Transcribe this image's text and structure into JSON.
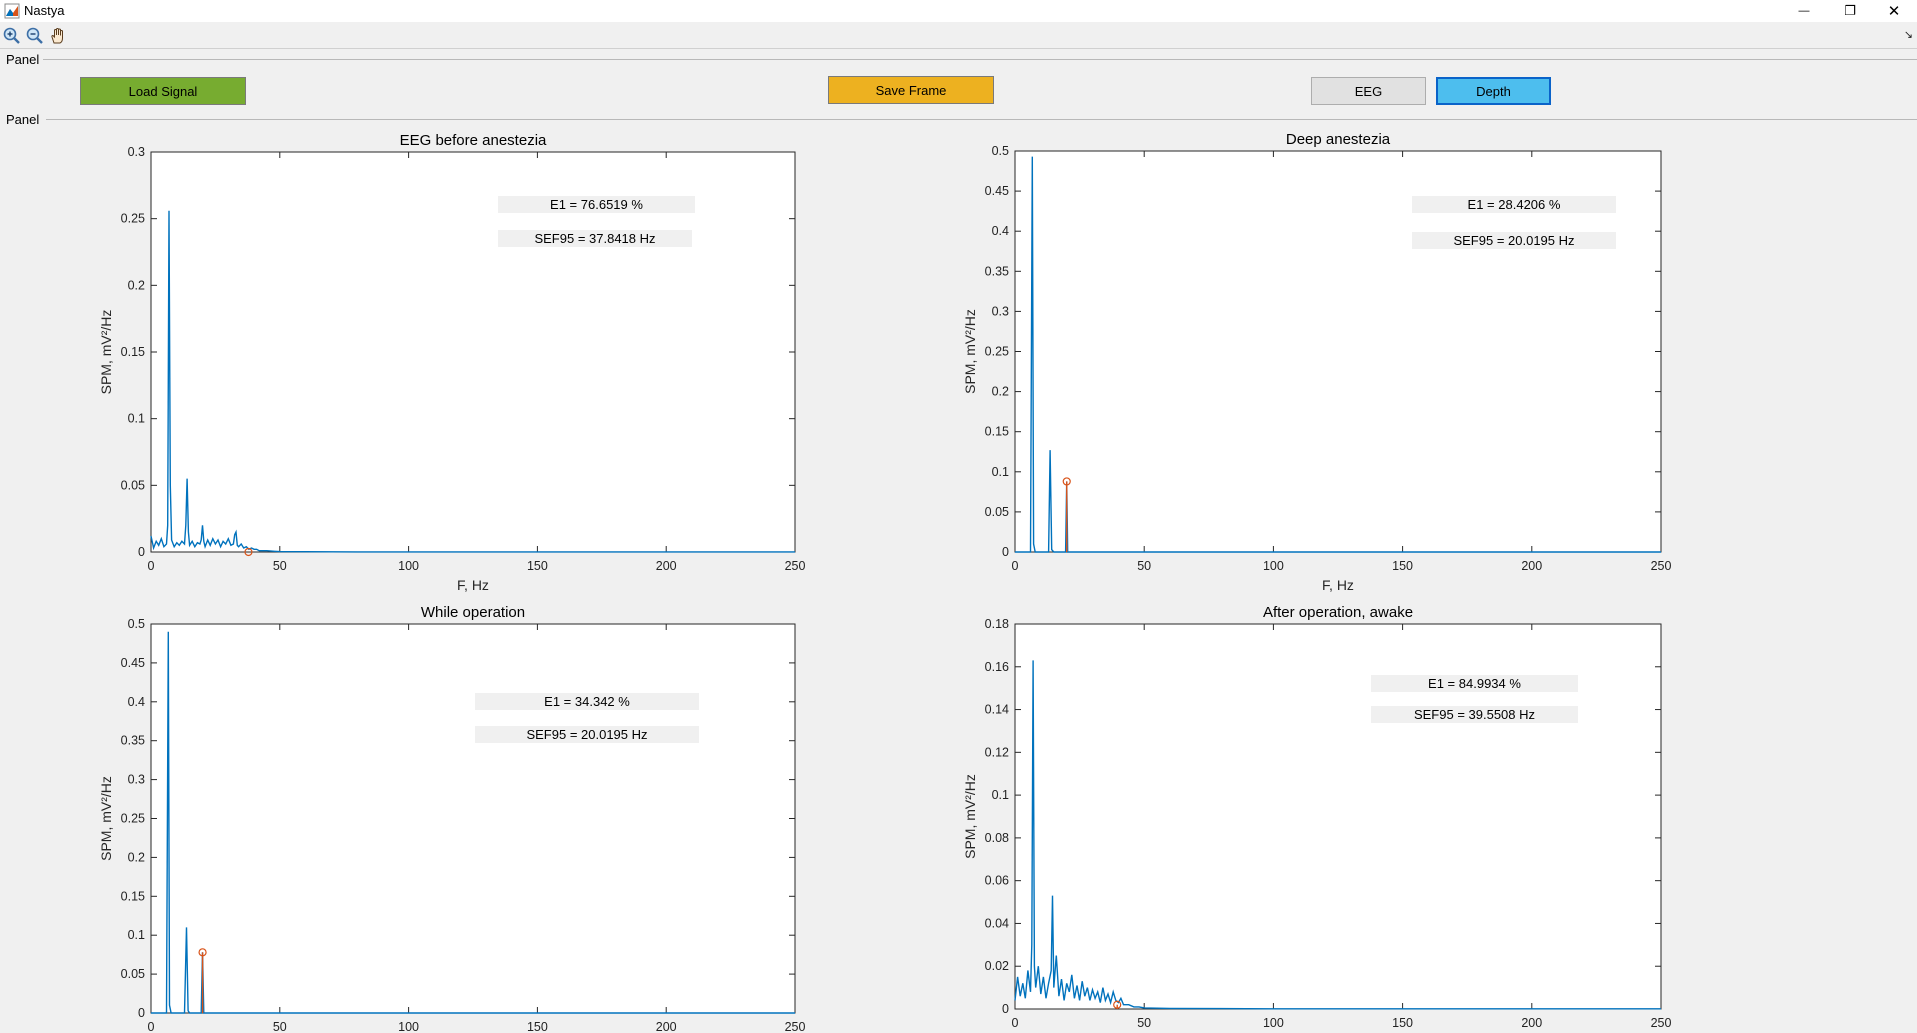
{
  "window": {
    "title": "Nastya",
    "minimize_glyph": "—",
    "restore_glyph": "❐",
    "close_glyph": "✕"
  },
  "toolbar": {
    "icons": [
      "zoom-in-icon",
      "zoom-out-icon",
      "pan-hand-icon"
    ],
    "expand_glyph": "↘"
  },
  "panels": {
    "top_label": "Panel",
    "bottom_label": "Panel"
  },
  "buttons": {
    "load_signal": "Load Signal",
    "save_frame": "Save Frame",
    "eeg": "EEG",
    "depth": "Depth"
  },
  "colors": {
    "spectrum_line": "#0072bd",
    "marker": "#d95319",
    "load_button": "#77ac30",
    "save_button": "#edb120",
    "depth_button": "#4dbeee",
    "info_box": "#f0f0f0"
  },
  "chart_data": [
    {
      "type": "line",
      "title": "EEG before anestezia",
      "xlabel": "F, Hz",
      "ylabel": "SPM, mV²/Hz",
      "xlim": [
        0,
        250
      ],
      "ylim": [
        0,
        0.3
      ],
      "xticks": [
        "0",
        "50",
        "100",
        "150",
        "200",
        "250"
      ],
      "yticks": [
        "0",
        "0.05",
        "0.1",
        "0.15",
        "0.2",
        "0.25",
        "0.3"
      ],
      "info": [
        "E1 = 76.6519 %",
        "SEF95 = 37.8418 Hz"
      ],
      "marker": {
        "x": 37.84,
        "y": 0
      },
      "series": [
        {
          "x": [
            0,
            1,
            2,
            3,
            4,
            5,
            6,
            6.5,
            7,
            7.5,
            8,
            9,
            10,
            11,
            12,
            13,
            13.5,
            14,
            14.5,
            15,
            16,
            17,
            18,
            19,
            19.5,
            20,
            20.5,
            21,
            22,
            23,
            24,
            25,
            26,
            27,
            28,
            29,
            30,
            31,
            32,
            32.5,
            33,
            33.5,
            34,
            35,
            36,
            37,
            38,
            39,
            40,
            41,
            42,
            45,
            48,
            50,
            60,
            80,
            100,
            150,
            200,
            250
          ],
          "y": [
            0.012,
            0.003,
            0.008,
            0.005,
            0.01,
            0.004,
            0.006,
            0.02,
            0.256,
            0.05,
            0.009,
            0.004,
            0.007,
            0.005,
            0.008,
            0.006,
            0.02,
            0.055,
            0.015,
            0.005,
            0.008,
            0.004,
            0.007,
            0.006,
            0.009,
            0.02,
            0.008,
            0.004,
            0.009,
            0.005,
            0.01,
            0.006,
            0.009,
            0.004,
            0.008,
            0.006,
            0.01,
            0.005,
            0.006,
            0.013,
            0.015,
            0.005,
            0.004,
            0.006,
            0.003,
            0.004,
            0.002,
            0.003,
            0.002,
            0.002,
            0.001,
            0.001,
            0.0005,
            0.0003,
            0.0002,
            0.0001,
            0.0001,
            0.0001,
            0.0001,
            0.0001
          ]
        }
      ]
    },
    {
      "type": "line",
      "title": "Deep anestezia",
      "xlabel": "F, Hz",
      "ylabel": "SPM, mV²/Hz",
      "xlim": [
        0,
        250
      ],
      "ylim": [
        0,
        0.5
      ],
      "xticks": [
        "0",
        "50",
        "100",
        "150",
        "200",
        "250"
      ],
      "yticks": [
        "0",
        "0.05",
        "0.1",
        "0.15",
        "0.2",
        "0.25",
        "0.3",
        "0.35",
        "0.4",
        "0.45",
        "0.5"
      ],
      "info": [
        "E1 = 28.4206 %",
        "SEF95 = 20.0195 Hz"
      ],
      "marker": {
        "x": 20.02,
        "y": 0.088
      },
      "series": [
        {
          "x": [
            0,
            6,
            6.7,
            7.2,
            7.8,
            12,
            13,
            13.6,
            14.2,
            15,
            19,
            19.6,
            20,
            20.4,
            21,
            30,
            50,
            100,
            150,
            200,
            250
          ],
          "y": [
            0,
            0,
            0.493,
            0.01,
            0,
            0,
            0,
            0.127,
            0.003,
            0,
            0,
            0,
            0.088,
            0,
            0,
            0,
            0,
            0,
            0,
            0,
            0
          ]
        }
      ]
    },
    {
      "type": "line",
      "title": "While operation",
      "xlabel": "",
      "ylabel": "SPM, mV²/Hz",
      "xlim": [
        0,
        250
      ],
      "ylim": [
        0,
        0.5
      ],
      "xticks": [
        "0",
        "50",
        "100",
        "150",
        "200",
        "250"
      ],
      "yticks": [
        "0",
        "0.05",
        "0.1",
        "0.15",
        "0.2",
        "0.25",
        "0.3",
        "0.35",
        "0.4",
        "0.45",
        "0.5"
      ],
      "info": [
        "E1 = 34.342 %",
        "SEF95 = 20.0195 Hz"
      ],
      "marker": {
        "x": 20.02,
        "y": 0.078
      },
      "series": [
        {
          "x": [
            0,
            6,
            6.7,
            7.2,
            7.8,
            13,
            13.8,
            14.4,
            15,
            19.5,
            20,
            20.5,
            21,
            30,
            50,
            100,
            150,
            200,
            250
          ],
          "y": [
            0,
            0,
            0.49,
            0.01,
            0,
            0,
            0.11,
            0.003,
            0,
            0,
            0.078,
            0,
            0,
            0,
            0,
            0,
            0,
            0,
            0
          ]
        }
      ]
    },
    {
      "type": "line",
      "title": "After operation, awake",
      "xlabel": "",
      "ylabel": "SPM, mV²/Hz",
      "xlim": [
        0,
        250
      ],
      "ylim": [
        0,
        0.18
      ],
      "xticks": [
        "0",
        "50",
        "100",
        "150",
        "200",
        "250"
      ],
      "yticks": [
        "0",
        "0.02",
        "0.04",
        "0.06",
        "0.08",
        "0.1",
        "0.12",
        "0.14",
        "0.16",
        "0.18"
      ],
      "info": [
        "E1 = 84.9934 %",
        "SEF95 = 39.5508 Hz"
      ],
      "marker": {
        "x": 39.55,
        "y": 0.002
      },
      "series": [
        {
          "x": [
            0,
            1,
            2,
            3,
            4,
            5,
            6,
            6.5,
            7,
            7.5,
            8,
            9,
            10,
            11,
            12,
            13,
            14,
            14.5,
            15,
            16,
            17,
            18,
            19,
            20,
            21,
            22,
            23,
            24,
            25,
            26,
            27,
            28,
            29,
            30,
            31,
            32,
            33,
            34,
            35,
            36,
            37,
            38,
            39,
            40,
            41,
            42,
            44,
            46,
            48,
            50,
            60,
            80,
            100,
            150,
            200,
            250
          ],
          "y": [
            0.004,
            0.015,
            0.006,
            0.012,
            0.005,
            0.018,
            0.008,
            0.03,
            0.163,
            0.02,
            0.01,
            0.02,
            0.007,
            0.015,
            0.005,
            0.012,
            0.018,
            0.053,
            0.01,
            0.025,
            0.006,
            0.014,
            0.004,
            0.012,
            0.008,
            0.016,
            0.005,
            0.011,
            0.004,
            0.013,
            0.006,
            0.01,
            0.004,
            0.009,
            0.005,
            0.008,
            0.003,
            0.01,
            0.004,
            0.007,
            0.003,
            0.008,
            0.004,
            0.003,
            0.005,
            0.002,
            0.002,
            0.001,
            0.001,
            0.0005,
            0.0003,
            0.0002,
            0.0001,
            0.0001,
            0.0001,
            0.0001
          ]
        }
      ]
    }
  ]
}
